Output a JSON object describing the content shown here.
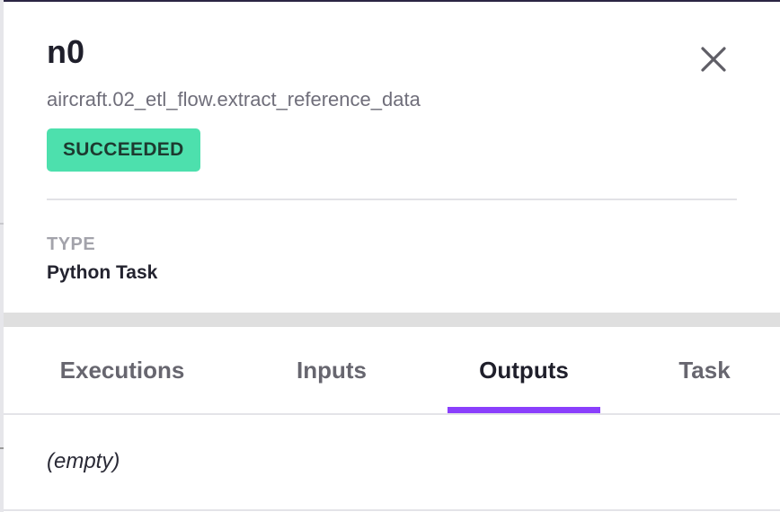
{
  "node": {
    "title": "n0",
    "path": "aircraft.02_etl_flow.extract_reference_data",
    "status": "SUCCEEDED",
    "type_label": "TYPE",
    "type_value": "Python Task"
  },
  "close": {
    "icon": "close-icon"
  },
  "tabs": [
    {
      "label": "Executions",
      "active": false
    },
    {
      "label": "Inputs",
      "active": false
    },
    {
      "label": "Outputs",
      "active": true
    },
    {
      "label": "Task",
      "active": false
    }
  ],
  "content": {
    "text": "(empty)"
  },
  "colors": {
    "status_badge_bg": "#4de0ad",
    "tab_active_indicator": "#8a3ffc",
    "title_text": "#1f1f2b"
  }
}
